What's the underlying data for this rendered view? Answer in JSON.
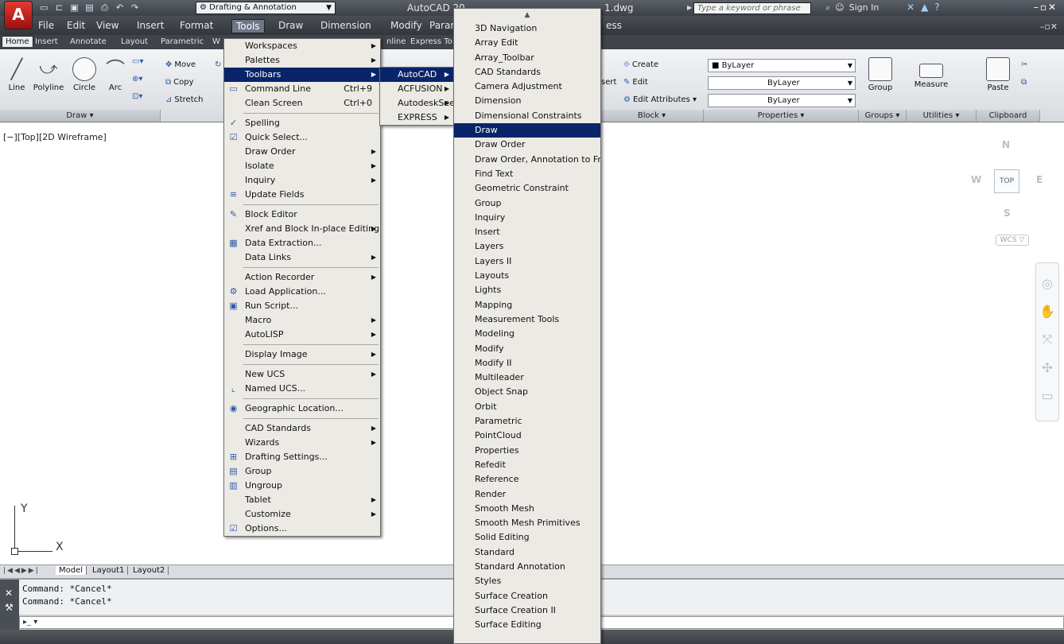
{
  "titlebar": {
    "workspace": "Drafting & Annotation",
    "app_title": "AutoCAD 20",
    "file_name": "1.dwg",
    "search_placeholder": "Type a keyword or phrase",
    "sign_in": "Sign In"
  },
  "menubar": {
    "items": [
      "File",
      "Edit",
      "View",
      "Insert",
      "Format",
      "Tools",
      "Draw",
      "Dimension",
      "Modify",
      "Param",
      "ess"
    ]
  },
  "ribbon_tabs": [
    "Home",
    "Insert",
    "Annotate",
    "Layout",
    "Parametric",
    "W",
    "nline",
    "Express To"
  ],
  "ribbon": {
    "draw": {
      "line": "Line",
      "polyline": "Polyline",
      "circle": "Circle",
      "arc": "Arc",
      "title": "Draw ▾"
    },
    "modify": {
      "move": "Move",
      "copy": "Copy",
      "stretch": "Stretch"
    },
    "block": {
      "insert": "sert",
      "create": "Create",
      "edit": "Edit",
      "edit_attributes": "Edit Attributes ▾",
      "title": "Block ▾"
    },
    "properties": {
      "color": "ByLayer",
      "linetype": "ByLayer",
      "lineweight": "ByLayer",
      "title": "Properties ▾"
    },
    "groups": {
      "group": "Group",
      "title": "Groups ▾"
    },
    "utilities": {
      "measure": "Measure",
      "title": "Utilities ▾"
    },
    "clipboard": {
      "paste": "Paste",
      "title": "Clipboard"
    }
  },
  "viewport": {
    "label": "[−][Top][2D Wireframe]",
    "viewcube": {
      "n": "N",
      "s": "S",
      "e": "E",
      "w": "W",
      "face": "TOP"
    },
    "wcs": "WCS ▽",
    "ucs_x": "X",
    "ucs_y": "Y"
  },
  "layout_tabs": [
    "Model",
    "Layout1",
    "Layout2"
  ],
  "command": {
    "history": [
      "Command: *Cancel*",
      "Command: *Cancel*"
    ],
    "prompt": "▸_ ▾"
  },
  "tools_menu": [
    {
      "label": "Workspaces",
      "sub": true
    },
    {
      "label": "Palettes",
      "sub": true
    },
    {
      "label": "Toolbars",
      "sub": true,
      "hl": true
    },
    {
      "label": "Command Line",
      "sc": "Ctrl+9",
      "icon": "▭"
    },
    {
      "label": "Clean Screen",
      "sc": "Ctrl+0"
    },
    {
      "sep": true
    },
    {
      "label": "Spelling",
      "icon": "✓"
    },
    {
      "label": "Quick Select...",
      "icon": "☑"
    },
    {
      "label": "Draw Order",
      "sub": true
    },
    {
      "label": "Isolate",
      "sub": true
    },
    {
      "label": "Inquiry",
      "sub": true
    },
    {
      "label": "Update Fields",
      "icon": "≡"
    },
    {
      "sep": true
    },
    {
      "label": "Block Editor",
      "icon": "✎"
    },
    {
      "label": "Xref and Block In-place Editing",
      "sub": true
    },
    {
      "label": "Data Extraction...",
      "icon": "▦"
    },
    {
      "label": "Data Links",
      "sub": true
    },
    {
      "sep": true
    },
    {
      "label": "Action Recorder",
      "sub": true
    },
    {
      "label": "Load Application...",
      "icon": "⚙"
    },
    {
      "label": "Run Script...",
      "icon": "▣"
    },
    {
      "label": "Macro",
      "sub": true
    },
    {
      "label": "AutoLISP",
      "sub": true
    },
    {
      "sep": true
    },
    {
      "label": "Display Image",
      "sub": true
    },
    {
      "sep": true
    },
    {
      "label": "New UCS",
      "sub": true
    },
    {
      "label": "Named UCS...",
      "icon": "⌞"
    },
    {
      "sep": true
    },
    {
      "label": "Geographic Location...",
      "icon": "◉"
    },
    {
      "sep": true
    },
    {
      "label": "CAD Standards",
      "sub": true
    },
    {
      "label": "Wizards",
      "sub": true
    },
    {
      "label": "Drafting Settings...",
      "icon": "⊞"
    },
    {
      "label": "Group",
      "icon": "▤"
    },
    {
      "label": "Ungroup",
      "icon": "▥"
    },
    {
      "label": "Tablet",
      "sub": true
    },
    {
      "label": "Customize",
      "sub": true
    },
    {
      "label": "Options...",
      "icon": "☑"
    }
  ],
  "toolbars_menu": [
    {
      "label": "AutoCAD",
      "hl": true
    },
    {
      "label": "ACFUSION"
    },
    {
      "label": "AutodeskSeek"
    },
    {
      "label": "EXPRESS"
    }
  ],
  "autocad_menu": {
    "scroll_up": "▲",
    "items": [
      "3D Navigation",
      "Array Edit",
      "Array_Toolbar",
      "CAD Standards",
      "Camera Adjustment",
      "Dimension",
      "Dimensional Constraints",
      "Draw",
      "Draw Order",
      "Draw Order, Annotation to Front",
      "Find Text",
      "Geometric Constraint",
      "Group",
      "Inquiry",
      "Insert",
      "Layers",
      "Layers II",
      "Layouts",
      "Lights",
      "Mapping",
      "Measurement Tools",
      "Modeling",
      "Modify",
      "Modify II",
      "Multileader",
      "Object Snap",
      "Orbit",
      "Parametric",
      "PointCloud",
      "Properties",
      "Refedit",
      "Reference",
      "Render",
      "Smooth Mesh",
      "Smooth Mesh Primitives",
      "Solid Editing",
      "Standard",
      "Standard Annotation",
      "Styles",
      "Surface Creation",
      "Surface Creation II",
      "Surface Editing"
    ],
    "highlighted": "Draw"
  }
}
